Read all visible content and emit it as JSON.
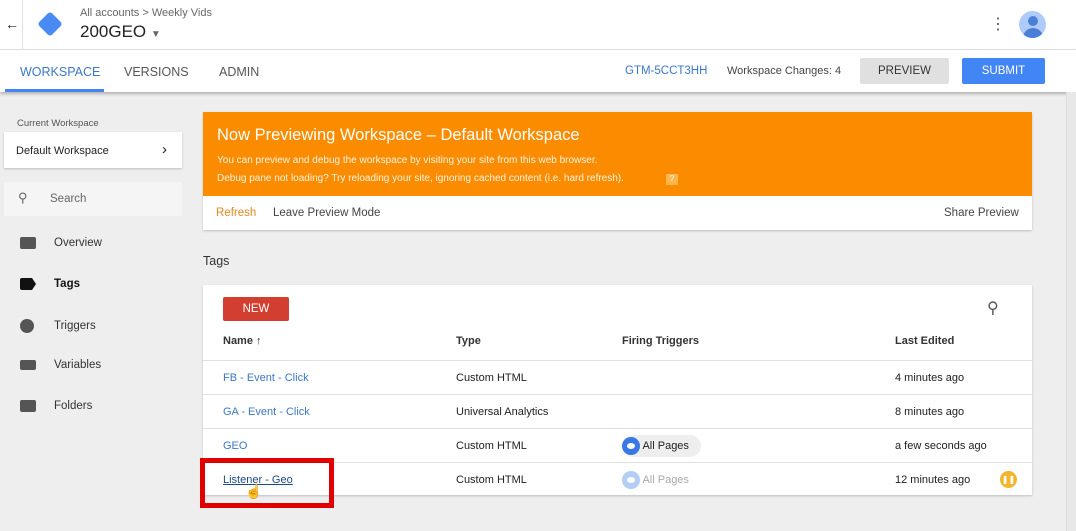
{
  "header": {
    "breadcrumb_root": "All accounts",
    "breadcrumb_sep": ">",
    "breadcrumb_account": "Weekly Vids",
    "container": "200GEO"
  },
  "tabs": [
    "WORKSPACE",
    "VERSIONS",
    "ADMIN"
  ],
  "toolbar": {
    "container_id": "GTM-5CCT3HH",
    "workspace_changes": "Workspace Changes: 4",
    "preview": "PREVIEW",
    "submit": "SUBMIT"
  },
  "sidebar": {
    "current_label": "Current Workspace",
    "current_value": "Default Workspace",
    "search_placeholder": "Search",
    "items": [
      {
        "label": "Overview"
      },
      {
        "label": "Tags"
      },
      {
        "label": "Triggers"
      },
      {
        "label": "Variables"
      },
      {
        "label": "Folders"
      }
    ]
  },
  "banner": {
    "title": "Now Previewing Workspace – Default Workspace",
    "line1": "You can preview and debug the workspace by visiting your site from this web browser.",
    "line2": "Debug pane not loading? Try reloading your site, ignoring cached content (i.e. hard refresh).",
    "help": "?",
    "refresh": "Refresh",
    "leave": "Leave Preview Mode",
    "share": "Share Preview"
  },
  "tags": {
    "section_title": "Tags",
    "new_label": "NEW",
    "columns": [
      "Name ↑",
      "Type",
      "Firing Triggers",
      "Last Edited"
    ],
    "rows": [
      {
        "name": "FB - Event - Click",
        "type": "Custom HTML",
        "trigger": "",
        "edited": "4 minutes ago"
      },
      {
        "name": "GA - Event - Click",
        "type": "Universal Analytics",
        "trigger": "",
        "edited": "8 minutes ago"
      },
      {
        "name": "GEO",
        "type": "Custom HTML",
        "trigger": "All Pages",
        "edited": "a few seconds ago"
      },
      {
        "name": "Listener - Geo",
        "type": "Custom HTML",
        "trigger": "All Pages",
        "edited": "12 minutes ago"
      }
    ]
  },
  "colors": {
    "accent": "#4285f4",
    "banner": "#fb8c00",
    "new": "#d23f31",
    "highlight": "#e00000"
  }
}
